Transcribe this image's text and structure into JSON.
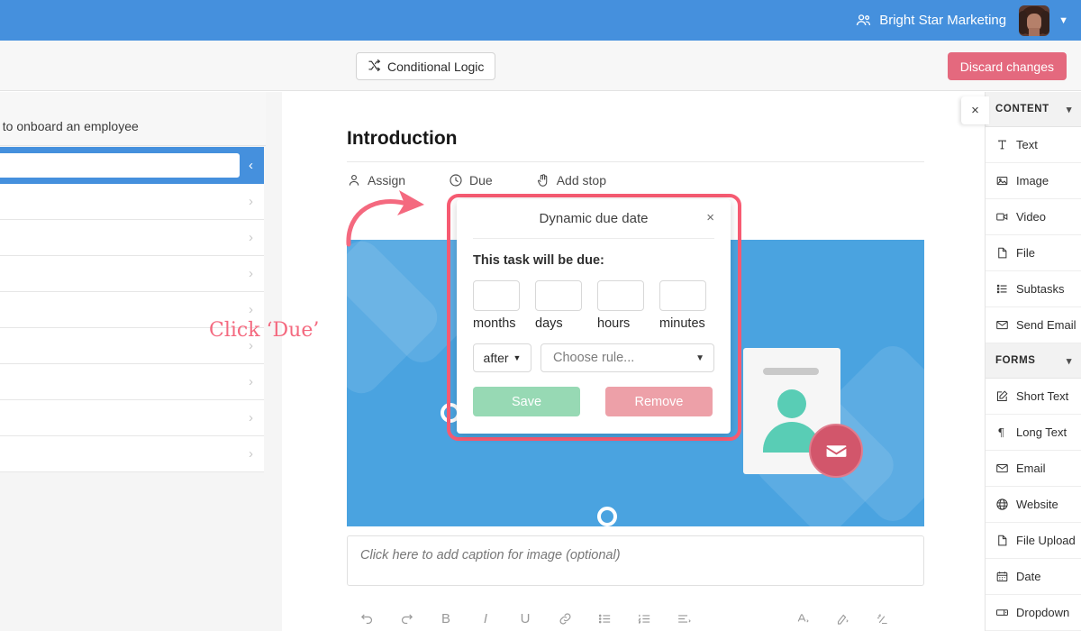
{
  "topbar": {
    "org_name": "Bright Star Marketing",
    "org_icon": "people-icon",
    "avatar": "user-avatar",
    "caret": "chevron-down-icon"
  },
  "toolbar": {
    "conditional_logic": "Conditional Logic",
    "discard": "Discard changes"
  },
  "left_panel": {
    "subtitle": "t to onboard an employee",
    "row_count": 9,
    "active_row_index": 0
  },
  "main": {
    "title": "Introduction",
    "actions": [
      {
        "label": "Assign",
        "icon": "person-icon"
      },
      {
        "label": "Due",
        "icon": "clock-icon"
      },
      {
        "label": "Add stop",
        "icon": "hand-icon"
      }
    ],
    "caption_placeholder": "Click here to add caption for image (optional)",
    "format_tools": [
      "undo-icon",
      "redo-icon",
      "bold-icon",
      "italic-icon",
      "underline-icon",
      "link-icon",
      "bullet-list-icon",
      "numbered-list-icon",
      "align-icon",
      "font-color-icon",
      "highlight-icon",
      "clear-format-icon"
    ]
  },
  "modal": {
    "title": "Dynamic due date",
    "close": "×",
    "prompt": "This task will be due:",
    "units": [
      {
        "label": "months",
        "value": ""
      },
      {
        "label": "days",
        "value": ""
      },
      {
        "label": "hours",
        "value": ""
      },
      {
        "label": "minutes",
        "value": ""
      }
    ],
    "relation": "after",
    "rule_placeholder": "Choose rule...",
    "save": "Save",
    "remove": "Remove"
  },
  "annotation": {
    "text": "Click ‘Due’",
    "arrow": "curved-arrow",
    "highlight_color": "#f75b72"
  },
  "right_panel": {
    "close_tab": "×",
    "sections": [
      {
        "title": "CONTENT",
        "items": [
          {
            "label": "Text",
            "icon": "text-icon"
          },
          {
            "label": "Image",
            "icon": "image-icon"
          },
          {
            "label": "Video",
            "icon": "video-icon"
          },
          {
            "label": "File",
            "icon": "file-icon"
          },
          {
            "label": "Subtasks",
            "icon": "list-icon"
          },
          {
            "label": "Send Email",
            "icon": "envelope-icon"
          }
        ]
      },
      {
        "title": "FORMS",
        "items": [
          {
            "label": "Short Text",
            "icon": "pencil-square-icon"
          },
          {
            "label": "Long Text",
            "icon": "paragraph-icon"
          },
          {
            "label": "Email",
            "icon": "envelope-icon"
          },
          {
            "label": "Website",
            "icon": "globe-icon"
          },
          {
            "label": "File Upload",
            "icon": "file-icon"
          },
          {
            "label": "Date",
            "icon": "calendar-icon"
          },
          {
            "label": "Dropdown",
            "icon": "dropdown-icon"
          }
        ]
      }
    ]
  },
  "colors": {
    "header_blue": "#4590dd",
    "image_blue": "#4aa3e0",
    "accent_pink": "#f75b72",
    "save_green": "#97d9b4",
    "remove_pink": "#eda0a8",
    "discard_red": "#e4697e"
  }
}
